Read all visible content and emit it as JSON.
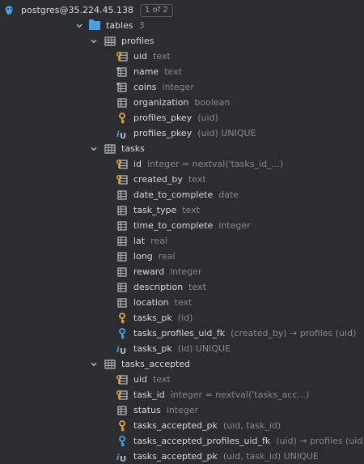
{
  "connection": {
    "name": "postgres@35.224.45.138",
    "page": "1 of 2"
  },
  "tables_node": {
    "label": "tables",
    "count": "3"
  },
  "tables": [
    {
      "name": "profiles",
      "items": [
        {
          "icon": "key-column-icon",
          "name": "uid",
          "meta": "text"
        },
        {
          "icon": "column-icon-notnull",
          "name": "name",
          "meta": "text"
        },
        {
          "icon": "column-icon-notnull",
          "name": "coins",
          "meta": "integer"
        },
        {
          "icon": "column-icon",
          "name": "organization",
          "meta": "boolean"
        },
        {
          "icon": "primary-key-icon",
          "name": "profiles_pkey",
          "meta": "(uid)"
        },
        {
          "icon": "unique-index-icon",
          "name": "profiles_pkey",
          "meta": "(uid) UNIQUE"
        }
      ]
    },
    {
      "name": "tasks",
      "items": [
        {
          "icon": "key-column-icon",
          "name": "id",
          "meta": "integer = nextval('tasks_id_...)"
        },
        {
          "icon": "key-column-icon",
          "name": "created_by",
          "meta": "text"
        },
        {
          "icon": "column-icon",
          "name": "date_to_complete",
          "meta": "date"
        },
        {
          "icon": "column-icon",
          "name": "task_type",
          "meta": "text"
        },
        {
          "icon": "column-icon",
          "name": "time_to_complete",
          "meta": "integer"
        },
        {
          "icon": "column-icon",
          "name": "lat",
          "meta": "real"
        },
        {
          "icon": "column-icon",
          "name": "long",
          "meta": "real"
        },
        {
          "icon": "column-icon",
          "name": "reward",
          "meta": "integer"
        },
        {
          "icon": "column-icon",
          "name": "description",
          "meta": "text"
        },
        {
          "icon": "column-icon",
          "name": "location",
          "meta": "text"
        },
        {
          "icon": "primary-key-icon",
          "name": "tasks_pk",
          "meta": "(id)"
        },
        {
          "icon": "foreign-key-icon",
          "name": "tasks_profiles_uid_fk",
          "meta": "(created_by) → profiles (uid)"
        },
        {
          "icon": "unique-index-icon",
          "name": "tasks_pk",
          "meta": "(id) UNIQUE"
        }
      ]
    },
    {
      "name": "tasks_accepted",
      "items": [
        {
          "icon": "key-column-icon",
          "name": "uid",
          "meta": "text"
        },
        {
          "icon": "key-column-icon",
          "name": "task_id",
          "meta": "integer = nextval('tasks_acc...)"
        },
        {
          "icon": "column-icon",
          "name": "status",
          "meta": "integer"
        },
        {
          "icon": "primary-key-icon",
          "name": "tasks_accepted_pk",
          "meta": "(uid, task_id)"
        },
        {
          "icon": "foreign-key-icon",
          "name": "tasks_accepted_profiles_uid_fk",
          "meta": "(uid) → profiles (uid)"
        },
        {
          "icon": "unique-index-icon",
          "name": "tasks_accepted_pk",
          "meta": "(uid, task_id) UNIQUE"
        }
      ]
    }
  ],
  "colors": {
    "background": "#2b2d30",
    "text": "#d7dae0",
    "secondary": "#868a91",
    "folder": "#49a0db",
    "key": "#e2a63b",
    "fk": "#4aa3df"
  }
}
